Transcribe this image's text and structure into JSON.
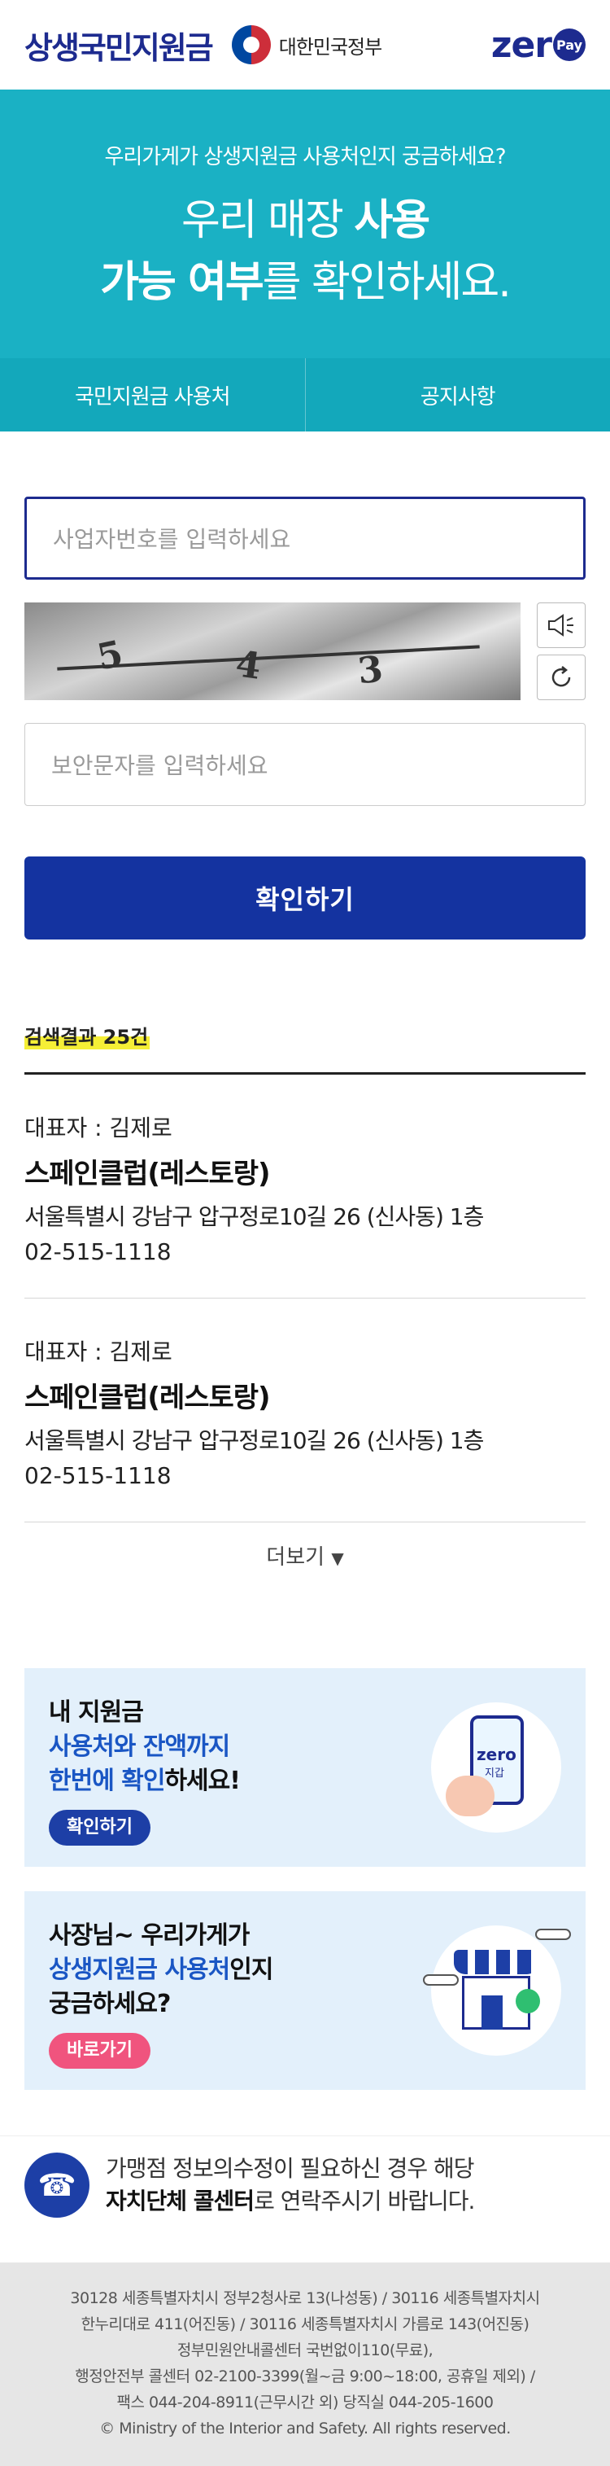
{
  "header": {
    "brand": "상생국민지원금",
    "gov_label": "대한민국정부",
    "zero_text": "zer",
    "pay_badge": "Pay"
  },
  "hero": {
    "subtitle": "우리가게가 상생지원금 사용처인지 궁금하세요?",
    "title_line1_normal": "우리 매장 ",
    "title_line1_bold": "사용",
    "title_line2_bold": "가능 여부",
    "title_line2_normal": "를 확인하세요."
  },
  "tabs": [
    {
      "label": "국민지원금 사용처"
    },
    {
      "label": "공지사항"
    }
  ],
  "form": {
    "business_placeholder": "사업자번호를 입력하세요",
    "security_placeholder": "보안문자를 입력하세요",
    "submit_label": "확인하기",
    "captcha_text": "5 4 3"
  },
  "results": {
    "count_label": "검색결과 25건",
    "items": [
      {
        "representative": "대표자 : 김제로",
        "name": "스페인클럽(레스토랑)",
        "address": "서울특별시 강남구 압구정로10길 26 (신사동) 1층",
        "phone": "02-515-1118"
      },
      {
        "representative": "대표자 : 김제로",
        "name": "스페인클럽(레스토랑)",
        "address": "서울특별시 강남구 압구정로10길 26 (신사동) 1층",
        "phone": "02-515-1118"
      }
    ],
    "more_label": "더보기"
  },
  "banner1": {
    "line1": "내 지원금",
    "line2_hl": "사용처와 잔액까지",
    "line3_hl": "한번에 확인",
    "line3_normal": "하세요!",
    "button": "확인하기",
    "phone_text": "zero",
    "phone_sub": "지갑"
  },
  "banner2": {
    "line1": "사장님~ 우리가게가",
    "line2_hl": "상생지원금 사용처",
    "line2_normal": "인지",
    "line3": "궁금하세요?",
    "button": "바로가기"
  },
  "contact": {
    "line1": "가맹점 정보의수정이 필요하신 경우 해당",
    "line2_bold": "자치단체 콜센터",
    "line2_normal": "로 연락주시기 바랍니다."
  },
  "footer": {
    "lines": [
      "30128 세종특별자치시 정부2청사로 13(나성동) / 30116 세종특별자치시",
      "한누리대로 411(어진동) / 30116 세종특별자치시 가름로 143(어진동)",
      "정부민원안내콜센터 국번없이110(무료),",
      "행정안전부 콜센터 02-2100-3399(월~금 9:00~18:00, 공휴일 제외) /",
      "팩스 044-204-8911(근무시간 외) 당직실 044-205-1600",
      "© Ministry of the Interior and Safety. All rights reserved."
    ]
  },
  "colors": {
    "brand_navy": "#1d2b8f",
    "hero_teal": "#1ab1c4",
    "submit_blue": "#1433a0",
    "highlight_yellow": "#f5ef36",
    "banner_bg": "#e3f0fb",
    "pink_button": "#f0547e"
  },
  "icons": {
    "speaker": "speaker-icon",
    "refresh": "refresh-icon",
    "caret": "caret-down-icon",
    "phone": "phone-icon"
  }
}
